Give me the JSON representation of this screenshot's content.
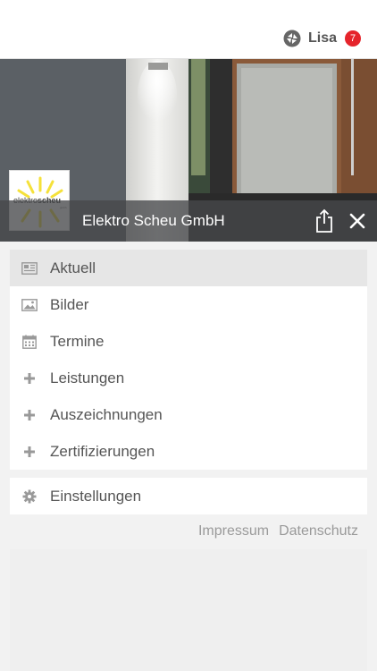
{
  "header": {
    "user_name": "Lisa",
    "notification_count": "7",
    "badge_color": "#e5242b"
  },
  "hero": {
    "company_name": "Elektro Scheu GmbH",
    "logo": {
      "word1": "elektro",
      "word2": "scheu",
      "sub": "gmbh"
    }
  },
  "menu": {
    "items": [
      {
        "label": "Aktuell",
        "icon": "newspaper-icon",
        "active": true
      },
      {
        "label": "Bilder",
        "icon": "image-icon"
      },
      {
        "label": "Termine",
        "icon": "calendar-icon"
      },
      {
        "label": "Leistungen",
        "icon": "plus-icon"
      },
      {
        "label": "Auszeichnungen",
        "icon": "plus-icon"
      },
      {
        "label": "Zertifizierungen",
        "icon": "plus-icon"
      }
    ],
    "settings": {
      "label": "Einstellungen",
      "icon": "gear-icon"
    }
  },
  "footer": {
    "impressum": "Impressum",
    "datenschutz": "Datenschutz"
  }
}
